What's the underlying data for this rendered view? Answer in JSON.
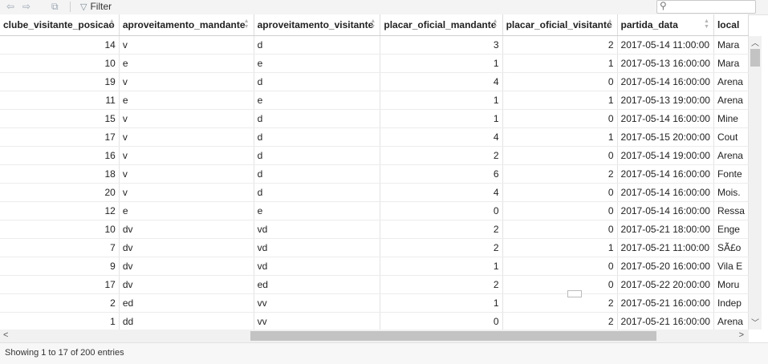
{
  "toolbar": {
    "back_icon": "arrow-left-icon",
    "forward_icon": "arrow-right-icon",
    "popout_icon": "popout-icon",
    "filter_label": "Filter",
    "search_value": ""
  },
  "table": {
    "columns": [
      "clube_visitante_posicao",
      "aproveitamento_mandante",
      "aproveitamento_visitante",
      "placar_oficial_mandante",
      "placar_oficial_visitante",
      "partida_data",
      "local"
    ],
    "rows": [
      [
        "14",
        "v",
        "d",
        "3",
        "2",
        "2017-05-14 11:00:00",
        "Mara"
      ],
      [
        "10",
        "e",
        "e",
        "1",
        "1",
        "2017-05-13 16:00:00",
        "Mara"
      ],
      [
        "19",
        "v",
        "d",
        "4",
        "0",
        "2017-05-14 16:00:00",
        "Arena"
      ],
      [
        "11",
        "e",
        "e",
        "1",
        "1",
        "2017-05-13 19:00:00",
        "Arena"
      ],
      [
        "15",
        "v",
        "d",
        "1",
        "0",
        "2017-05-14 16:00:00",
        "Mine"
      ],
      [
        "17",
        "v",
        "d",
        "4",
        "1",
        "2017-05-15 20:00:00",
        "Cout"
      ],
      [
        "16",
        "v",
        "d",
        "2",
        "0",
        "2017-05-14 19:00:00",
        "Arena"
      ],
      [
        "18",
        "v",
        "d",
        "6",
        "2",
        "2017-05-14 16:00:00",
        "Fonte"
      ],
      [
        "20",
        "v",
        "d",
        "4",
        "0",
        "2017-05-14 16:00:00",
        "Mois."
      ],
      [
        "12",
        "e",
        "e",
        "0",
        "0",
        "2017-05-14 16:00:00",
        "Ressa"
      ],
      [
        "10",
        "dv",
        "vd",
        "2",
        "0",
        "2017-05-21 18:00:00",
        "Enge"
      ],
      [
        "7",
        "dv",
        "vd",
        "2",
        "1",
        "2017-05-21 11:00:00",
        "SÃ£o"
      ],
      [
        "9",
        "dv",
        "vd",
        "1",
        "0",
        "2017-05-20 16:00:00",
        "Vila E"
      ],
      [
        "17",
        "dv",
        "ed",
        "2",
        "0",
        "2017-05-22 20:00:00",
        "Moru"
      ],
      [
        "2",
        "ed",
        "vv",
        "1",
        "2",
        "2017-05-21 16:00:00",
        "Indep"
      ],
      [
        "1",
        "dd",
        "vv",
        "0",
        "2",
        "2017-05-21 16:00:00",
        "Arena"
      ]
    ]
  },
  "footer": {
    "status": "Showing 1 to 17 of 200 entries"
  }
}
